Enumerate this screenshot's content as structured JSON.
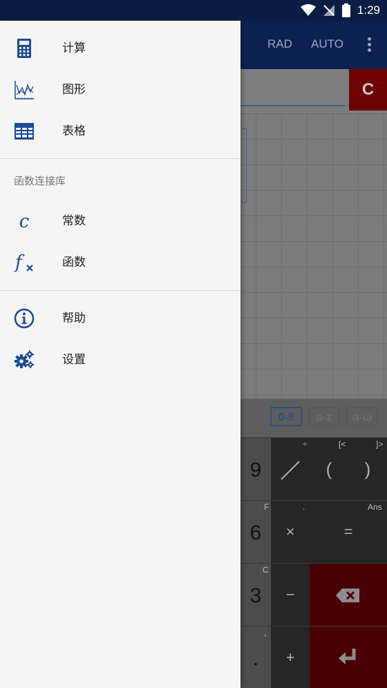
{
  "status": {
    "time": "1:29"
  },
  "app": {
    "actions": {
      "rad": "RAD",
      "auto": "AUTO"
    },
    "clear_label": "C",
    "modes": [
      "0-9",
      "a-z",
      "α-ω"
    ],
    "keys": {
      "nine": "9",
      "six": "6",
      "three": "3",
      "dot": ".",
      "divide_sub": "÷",
      "bracket_left_sub": "[<",
      "bracket_right_sub": "]>",
      "six_sub": "F",
      "times_sub": ".",
      "ans_sub": "Ans",
      "three_sub": "C",
      "dot_sub": ",",
      "open_paren": "(",
      "close_paren": ")",
      "times": "×",
      "equals": "=",
      "minus": "−",
      "plus": "+"
    }
  },
  "drawer": {
    "items_top": [
      {
        "label": "计算",
        "icon": "calculator-icon"
      },
      {
        "label": "图形",
        "icon": "graph-icon"
      },
      {
        "label": "表格",
        "icon": "table-icon"
      }
    ],
    "section_title": "函数连接库",
    "items_lib": [
      {
        "label": "常数",
        "icon": "constant-icon",
        "glyph": "c"
      },
      {
        "label": "函数",
        "icon": "function-icon",
        "glyph": "f"
      }
    ],
    "items_bottom": [
      {
        "label": "帮助",
        "icon": "info-icon"
      },
      {
        "label": "设置",
        "icon": "gears-icon"
      }
    ],
    "accent": "#1c4a96"
  }
}
